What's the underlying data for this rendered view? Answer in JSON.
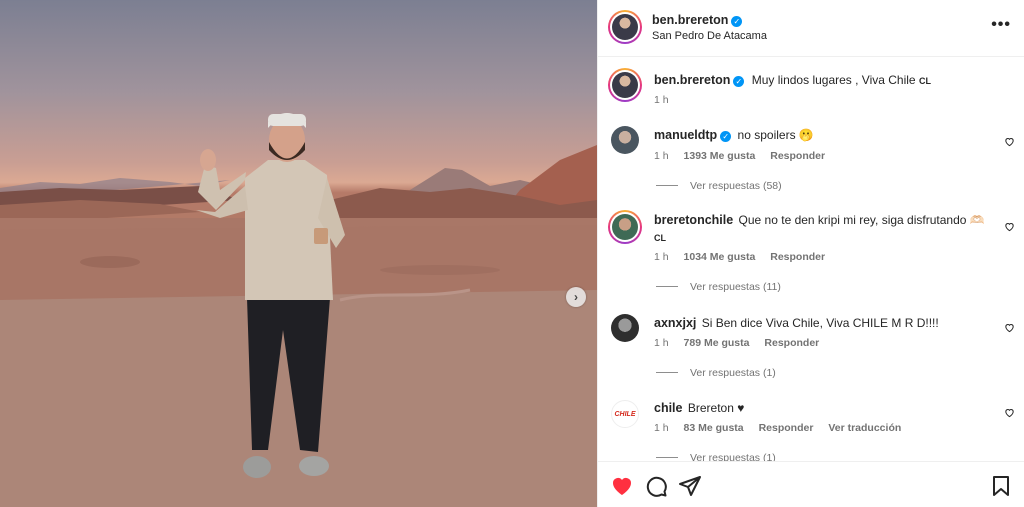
{
  "photo": {
    "next_icon": "chevron-right-icon"
  },
  "post": {
    "author": "ben.brereton",
    "location": "San Pedro De Atacama",
    "caption_user": "ben.brereton",
    "caption": "Muy lindos lugares , Viva Chile",
    "caption_flag": "CL",
    "caption_time": "1 h"
  },
  "comments": [
    {
      "user": "manueldtp",
      "verified": true,
      "text": "no spoilers",
      "emoji": "🫢",
      "time": "1 h",
      "likes": "1393 Me gusta",
      "reply": "Responder",
      "view_replies": "Ver respuestas (58)"
    },
    {
      "user": "breretonchile",
      "verified": false,
      "text": "Que no te den kripi mi rey, siga disfrutando",
      "emoji": "🫶🏻",
      "flag": "CL",
      "time": "1 h",
      "likes": "1034 Me gusta",
      "reply": "Responder",
      "view_replies": "Ver respuestas (11)"
    },
    {
      "user": "axnxjxj",
      "verified": false,
      "text": "Si Ben dice Viva Chile, Viva CHILE M R D!!!!",
      "time": "1 h",
      "likes": "789 Me gusta",
      "reply": "Responder",
      "view_replies": "Ver respuestas (1)"
    },
    {
      "user": "chile",
      "verified": false,
      "text": "Brereton ♥",
      "avatar_text": "CHILE",
      "time": "1 h",
      "likes": "83 Me gusta",
      "reply": "Responder",
      "translate": "Ver traducción",
      "view_replies": "Ver respuestas (1)"
    }
  ],
  "colors": {
    "like_red": "#ff3040",
    "verified_blue": "#0095f6",
    "meta_gray": "#737373"
  }
}
